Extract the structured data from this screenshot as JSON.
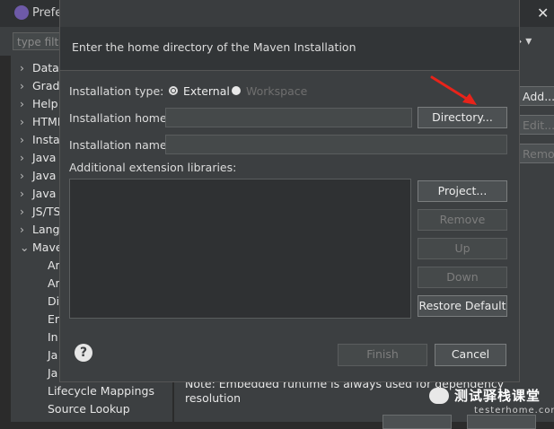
{
  "background_window": {
    "title": "Prefe",
    "filter_placeholder": "type filte",
    "close_glyph": "✕",
    "tree_items": [
      {
        "chevron": "›",
        "label": "Data"
      },
      {
        "chevron": "›",
        "label": "Grad"
      },
      {
        "chevron": "›",
        "label": "Help"
      },
      {
        "chevron": "›",
        "label": "HTML"
      },
      {
        "chevron": "›",
        "label": "Instal"
      },
      {
        "chevron": "›",
        "label": "Java"
      },
      {
        "chevron": "›",
        "label": "Java"
      },
      {
        "chevron": "›",
        "label": "Java"
      },
      {
        "chevron": "›",
        "label": "JS/TS"
      },
      {
        "chevron": "›",
        "label": "Langu"
      },
      {
        "chevron": "⌄",
        "label": "Mave"
      }
    ],
    "tree_sub_items": [
      "Ar",
      "Ar",
      "Di",
      "Er",
      "In",
      "Ja",
      "Ja",
      "Lifecycle Mappings",
      "Source Lookup"
    ],
    "right_buttons": {
      "add": "Add...",
      "edit": "Edit...",
      "remove": "Remove"
    },
    "note": "Note: Embedded runtime is always used for dependency resolution"
  },
  "watermark": {
    "text": "测试驿栈课堂",
    "sub": "testerhome.com"
  },
  "dialog": {
    "message": "Enter the home directory of the Maven Installation",
    "installation_type_label": "Installation type:",
    "radio_external": "External",
    "radio_workspace": "Workspace",
    "installation_home_label": "Installation home:",
    "installation_home_value": "",
    "installation_name_label": "Installation name:",
    "installation_name_value": "",
    "extension_libs_label": "Additional extension libraries:",
    "buttons": {
      "directory": "Directory...",
      "project": "Project...",
      "remove": "Remove",
      "up": "Up",
      "down": "Down",
      "restore_default": "Restore Default",
      "finish": "Finish",
      "cancel": "Cancel"
    },
    "help_glyph": "?"
  },
  "colors": {
    "annotation_arrow": "#e8231a",
    "dialog_bg": "#3c3f41"
  }
}
